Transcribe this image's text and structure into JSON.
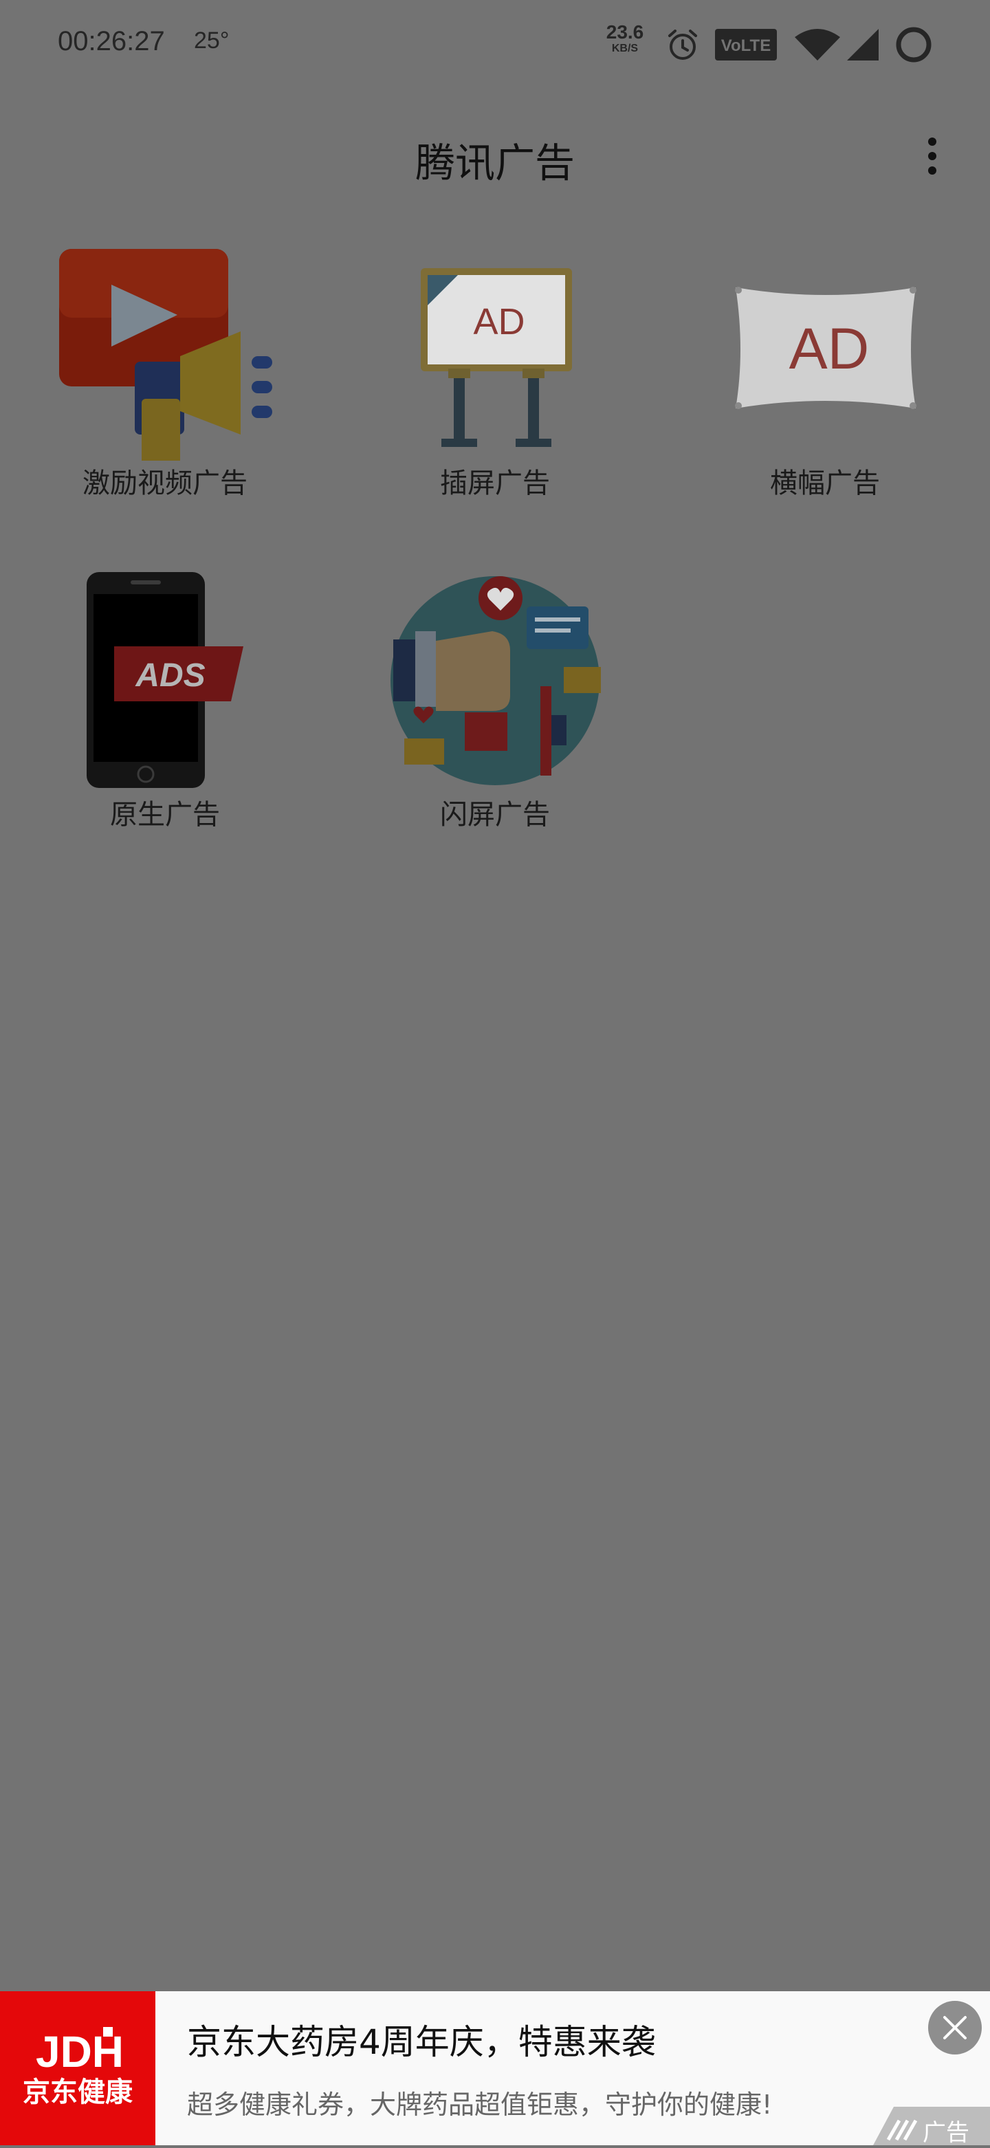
{
  "status_bar": {
    "time": "00:26:27",
    "temperature": "25°",
    "net_speed_value": "23.6",
    "net_speed_unit": "KB/S",
    "icons": [
      "alarm-icon",
      "volte-icon",
      "wifi-icon",
      "cell-signal-icon",
      "battery-ring-icon"
    ]
  },
  "app_bar": {
    "title": "腾讯广告",
    "menu_icon": "more-vert-icon"
  },
  "grid": {
    "items": [
      {
        "label": "激励视频广告",
        "icon": "video-megaphone-icon"
      },
      {
        "label": "插屏广告",
        "icon": "ad-billboard-icon"
      },
      {
        "label": "横幅广告",
        "icon": "ad-banner-icon"
      },
      {
        "label": "原生广告",
        "icon": "phone-ads-icon"
      },
      {
        "label": "闪屏广告",
        "icon": "social-thumbs-up-icon"
      }
    ]
  },
  "ad_banner": {
    "logo_text": "JDH",
    "logo_subtext": "京东健康",
    "title": "京东大药房4周年庆，特惠来袭",
    "description": "超多健康礼券，大牌药品超值钜惠，守护你的健康!",
    "tag_label": "广告",
    "close_icon": "close-icon"
  },
  "colors": {
    "overlay_background": "#737373",
    "jd_red": "#e4080a"
  }
}
